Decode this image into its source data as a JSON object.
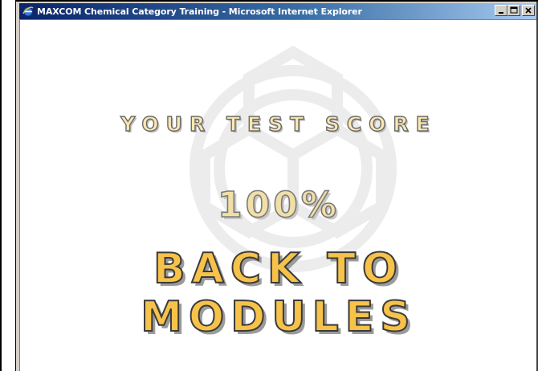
{
  "window": {
    "title": "MAXCOM Chemical Category Training - Microsoft Internet Explorer",
    "controls": {
      "minimize_icon": "minimize-icon",
      "maximize_icon": "maximize-icon",
      "close_icon": "close-icon"
    }
  },
  "page": {
    "heading": "YOUR TEST SCORE",
    "score": "100%",
    "back_link": {
      "line1": "BACK TO",
      "line2": "MODULES"
    }
  },
  "colors": {
    "titlebar_start": "#0a246a",
    "titlebar_end": "#a6caf0",
    "heading_fill": "#fbe7b0",
    "score_fill": "#f2dfa7",
    "link_fill": "#f6c24a",
    "outline": "#3a3a3a"
  }
}
